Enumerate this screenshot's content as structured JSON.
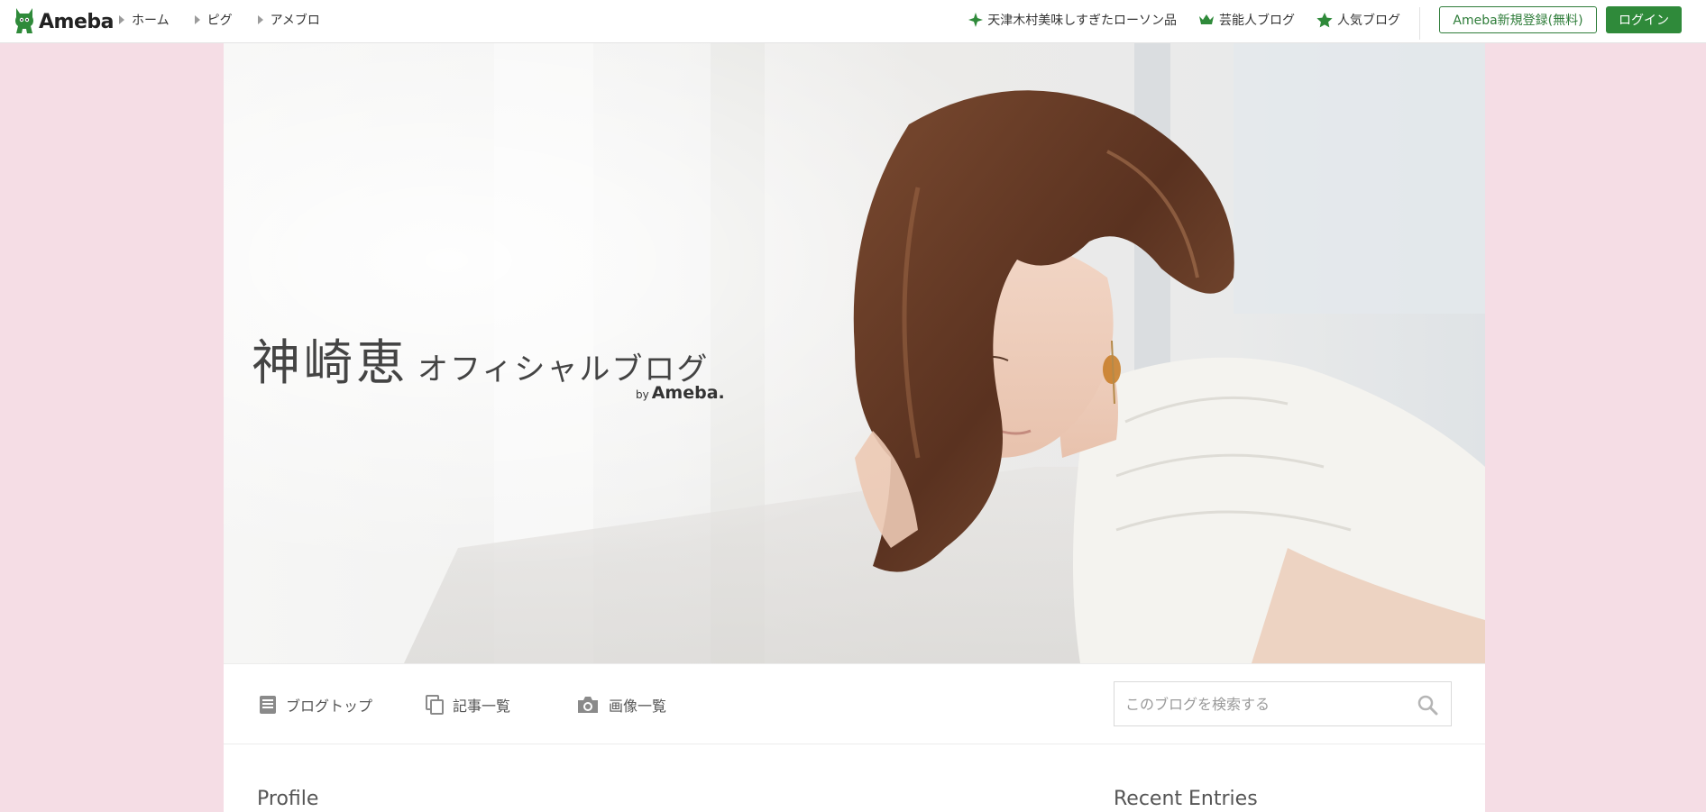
{
  "header": {
    "logo_text": "Ameba",
    "breadcrumbs": [
      "ホーム",
      "ピグ",
      "アメブロ"
    ],
    "links": [
      {
        "label": "天津木村美味しすぎたローソン品",
        "icon": "sparkle-icon"
      },
      {
        "label": "芸能人ブログ",
        "icon": "crown-icon"
      },
      {
        "label": "人気ブログ",
        "icon": "star-icon"
      }
    ],
    "register_label": "Ameba新規登録(無料)",
    "login_label": "ログイン"
  },
  "hero": {
    "title_name": "神崎恵",
    "title_sub": "オフィシャルブログ",
    "by_text": "by",
    "by_brand": "Ameba."
  },
  "nav": {
    "items": [
      {
        "label": "ブログトップ",
        "icon": "document-icon"
      },
      {
        "label": "記事一覧",
        "icon": "copy-icon"
      },
      {
        "label": "画像一覧",
        "icon": "camera-icon"
      }
    ],
    "search_placeholder": "このブログを検索する"
  },
  "sections": {
    "profile_title": "Profile",
    "recent_title": "Recent Entries"
  },
  "colors": {
    "page_bg": "#f5dde5",
    "brand_green": "#2f8a3a"
  }
}
